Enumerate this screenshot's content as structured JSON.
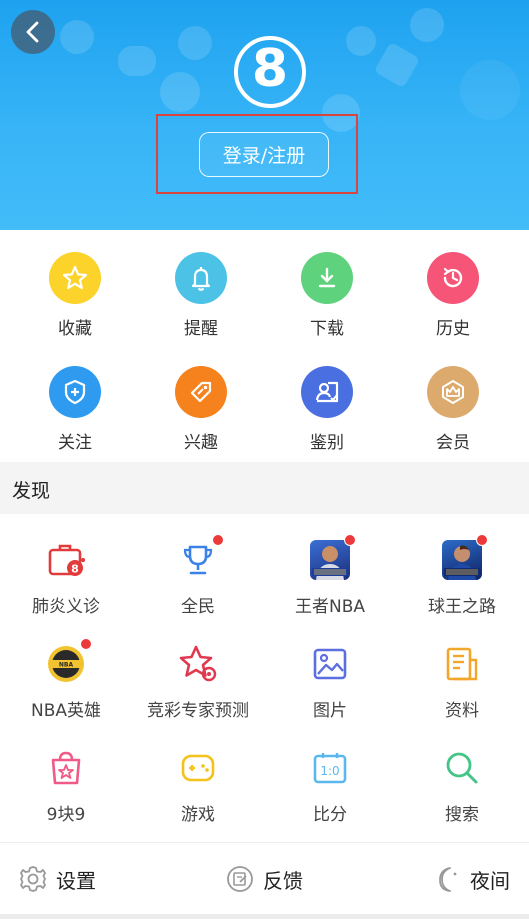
{
  "header": {
    "logo_text": "8",
    "login_label": "登录/注册",
    "accent_color": "#2aa9f2"
  },
  "quick_actions": [
    {
      "label": "收藏",
      "icon": "star-icon",
      "color": "#fbd32a"
    },
    {
      "label": "提醒",
      "icon": "bell-icon",
      "color": "#4cc3e6"
    },
    {
      "label": "下载",
      "icon": "download-icon",
      "color": "#5ed27c"
    },
    {
      "label": "历史",
      "icon": "history-icon",
      "color": "#f65577"
    },
    {
      "label": "关注",
      "icon": "shield-plus-icon",
      "color": "#2f9bf0"
    },
    {
      "label": "兴趣",
      "icon": "tag-icon",
      "color": "#f6821e"
    },
    {
      "label": "鉴别",
      "icon": "identify-icon",
      "color": "#4a6fe0"
    },
    {
      "label": "会员",
      "icon": "vip-crown-icon",
      "color": "#dcaa6c"
    }
  ],
  "discover": {
    "title": "发现",
    "items": [
      {
        "label": "肺炎义诊",
        "icon": "medical-kit-icon",
        "dot": false
      },
      {
        "label": "全民",
        "icon": "trophy-icon",
        "dot": true
      },
      {
        "label": "王者NBA",
        "icon": "nba-king-avatar-icon",
        "dot": true
      },
      {
        "label": "球王之路",
        "icon": "football-king-avatar-icon",
        "dot": true
      },
      {
        "label": "NBA英雄",
        "icon": "nba-hero-badge-icon",
        "dot": true
      },
      {
        "label": "竞彩专家预测",
        "icon": "lottery-star-icon",
        "dot": false
      },
      {
        "label": "图片",
        "icon": "picture-icon",
        "dot": false
      },
      {
        "label": "资料",
        "icon": "document-icon",
        "dot": false
      },
      {
        "label": "9块9",
        "icon": "shopping-bag-icon",
        "dot": false
      },
      {
        "label": "游戏",
        "icon": "gamepad-icon",
        "dot": false
      },
      {
        "label": "比分",
        "icon": "scoreboard-icon",
        "dot": false
      },
      {
        "label": "搜索",
        "icon": "search-icon",
        "dot": false
      }
    ]
  },
  "footer": {
    "settings_label": "设置",
    "feedback_label": "反馈",
    "night_label": "夜间"
  }
}
